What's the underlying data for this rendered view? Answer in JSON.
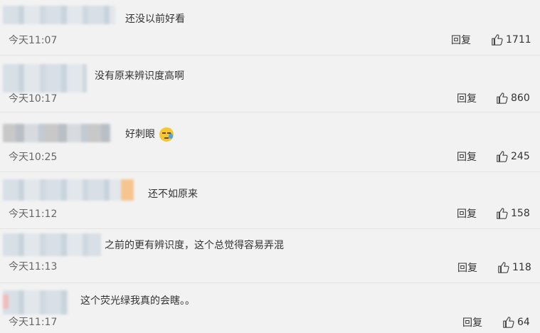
{
  "comments": [
    {
      "text": "还没以前好看",
      "time": "今天11:07",
      "reply": "回复",
      "likes": "1711"
    },
    {
      "text": "没有原来辨识度高啊",
      "time": "今天10:17",
      "reply": "回复",
      "likes": "860"
    },
    {
      "text": "好刺眼",
      "emoji": "sweat-face-emoji",
      "time": "今天10:25",
      "reply": "回复",
      "likes": "245"
    },
    {
      "text": "还不如原来",
      "time": "今天11:12",
      "reply": "回复",
      "likes": "158"
    },
    {
      "text": "之前的更有辨识度，这个总觉得容易弄混",
      "time": "今天11:13",
      "reply": "回复",
      "likes": "118"
    },
    {
      "text": "这个荧光绿我真的会瞎。。",
      "time": "今天11:17",
      "reply": "回复",
      "likes": "64"
    }
  ],
  "icons": {
    "like": "thumbs-up-icon"
  },
  "colors": {
    "background": "#f2f2f2",
    "text": "#333333",
    "time": "#666666"
  }
}
